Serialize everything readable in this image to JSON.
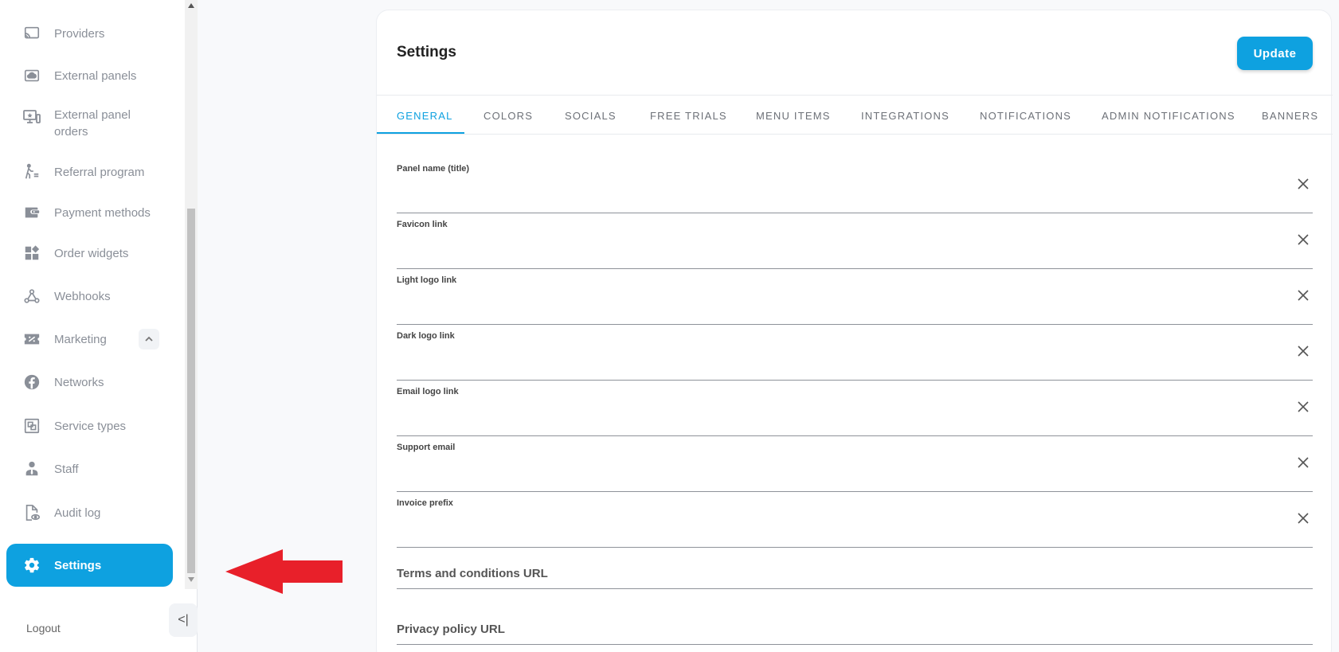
{
  "sidebar": {
    "items": [
      {
        "label": "Providers",
        "icon": "cast-icon"
      },
      {
        "label": "External panels",
        "icon": "cloud-panel-icon"
      },
      {
        "label": "External panel orders",
        "label_line1": "External panel",
        "label_line2": "orders",
        "icon": "monitor-star-icon"
      },
      {
        "label": "Referral program",
        "icon": "walking-person-icon"
      },
      {
        "label": "Payment methods",
        "icon": "wallet-icon"
      },
      {
        "label": "Order widgets",
        "icon": "widgets-icon"
      },
      {
        "label": "Webhooks",
        "icon": "webhook-icon"
      },
      {
        "label": "Marketing",
        "icon": "ticket-percent-icon"
      },
      {
        "label": "Networks",
        "icon": "facebook-icon"
      },
      {
        "label": "Service types",
        "icon": "service-types-icon"
      },
      {
        "label": "Staff",
        "icon": "person-tie-icon"
      },
      {
        "label": "Audit log",
        "icon": "file-eye-icon"
      },
      {
        "label": "Settings",
        "icon": "gear-icon",
        "active": true
      }
    ],
    "logout_label": "Logout",
    "collapse_label": "<|"
  },
  "main": {
    "title": "Settings",
    "update_label": "Update",
    "tabs": [
      "GENERAL",
      "COLORS",
      "SOCIALS",
      "FREE TRIALS",
      "MENU ITEMS",
      "INTEGRATIONS",
      "NOTIFICATIONS",
      "ADMIN NOTIFICATIONS",
      "BANNERS"
    ],
    "active_tab": "GENERAL",
    "fields": [
      {
        "label": "Panel name (title)",
        "value": ""
      },
      {
        "label": "Favicon link",
        "value": ""
      },
      {
        "label": "Light logo link",
        "value": ""
      },
      {
        "label": "Dark logo link",
        "value": ""
      },
      {
        "label": "Email logo link",
        "value": ""
      },
      {
        "label": "Support email",
        "value": ""
      },
      {
        "label": "Invoice prefix",
        "value": ""
      }
    ],
    "url_fields": [
      {
        "label": "Terms and conditions URL"
      },
      {
        "label": "Privacy policy URL"
      }
    ]
  },
  "colors": {
    "accent": "#0ea1e0",
    "arrow": "#e8202a",
    "muted_text": "#8a8f98"
  }
}
